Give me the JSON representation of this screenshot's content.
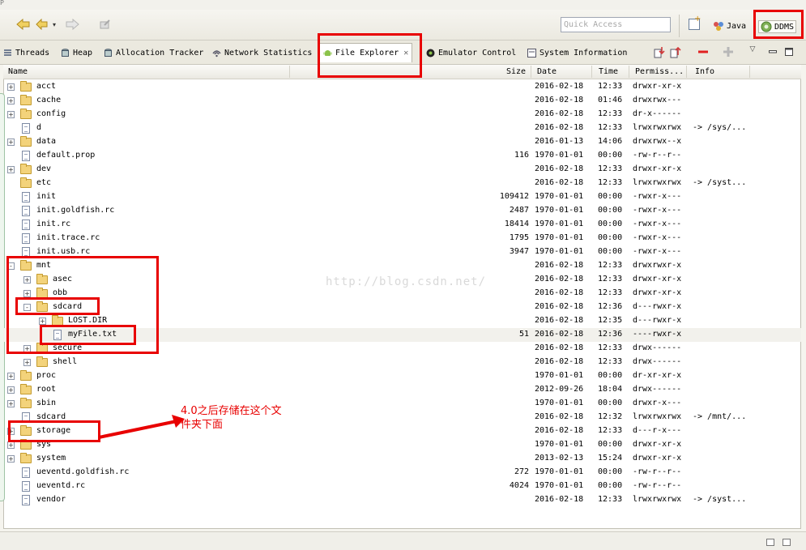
{
  "window": {
    "corner_letter": "P"
  },
  "toolbar": {
    "quick_access_placeholder": "Quick Access",
    "java_label": "Java",
    "ddms_label": "DDMS"
  },
  "tabs": [
    {
      "label": "Threads",
      "icon": "threads-icon"
    },
    {
      "label": "Heap",
      "icon": "heap-icon"
    },
    {
      "label": "Allocation Tracker",
      "icon": "allocation-icon"
    },
    {
      "label": "Network Statistics",
      "icon": "network-icon"
    },
    {
      "label": "File Explorer",
      "icon": "android-icon",
      "active": true
    },
    {
      "label": "Emulator Control",
      "icon": "emulator-icon"
    },
    {
      "label": "System Information",
      "icon": "system-info-icon"
    }
  ],
  "columns": {
    "name": "Name",
    "size": "Size",
    "date": "Date",
    "time": "Time",
    "permissions": "Permiss...",
    "info": "Info"
  },
  "rows": [
    {
      "name": "acct",
      "type": "folder",
      "level": 0,
      "expander": "+",
      "size": "",
      "date": "2016-02-18",
      "time": "12:33",
      "perm": "drwxr-xr-x",
      "info": ""
    },
    {
      "name": "cache",
      "type": "folder",
      "level": 0,
      "expander": "+",
      "size": "",
      "date": "2016-02-18",
      "time": "01:46",
      "perm": "drwxrwx---",
      "info": ""
    },
    {
      "name": "config",
      "type": "folder",
      "level": 0,
      "expander": "+",
      "size": "",
      "date": "2016-02-18",
      "time": "12:33",
      "perm": "dr-x------",
      "info": ""
    },
    {
      "name": "d",
      "type": "file",
      "level": 0,
      "expander": "",
      "size": "",
      "date": "2016-02-18",
      "time": "12:33",
      "perm": "lrwxrwxrwx",
      "info": "-> /sys/..."
    },
    {
      "name": "data",
      "type": "folder",
      "level": 0,
      "expander": "+",
      "size": "",
      "date": "2016-01-13",
      "time": "14:06",
      "perm": "drwxrwx--x",
      "info": ""
    },
    {
      "name": "default.prop",
      "type": "file",
      "level": 0,
      "expander": "",
      "size": "116",
      "date": "1970-01-01",
      "time": "00:00",
      "perm": "-rw-r--r--",
      "info": ""
    },
    {
      "name": "dev",
      "type": "folder",
      "level": 0,
      "expander": "+",
      "size": "",
      "date": "2016-02-18",
      "time": "12:33",
      "perm": "drwxr-xr-x",
      "info": ""
    },
    {
      "name": "etc",
      "type": "folder",
      "level": 0,
      "expander": "",
      "size": "",
      "date": "2016-02-18",
      "time": "12:33",
      "perm": "lrwxrwxrwx",
      "info": "-> /syst..."
    },
    {
      "name": "init",
      "type": "file",
      "level": 0,
      "expander": "",
      "size": "109412",
      "date": "1970-01-01",
      "time": "00:00",
      "perm": "-rwxr-x---",
      "info": ""
    },
    {
      "name": "init.goldfish.rc",
      "type": "file",
      "level": 0,
      "expander": "",
      "size": "2487",
      "date": "1970-01-01",
      "time": "00:00",
      "perm": "-rwxr-x---",
      "info": ""
    },
    {
      "name": "init.rc",
      "type": "file",
      "level": 0,
      "expander": "",
      "size": "18414",
      "date": "1970-01-01",
      "time": "00:00",
      "perm": "-rwxr-x---",
      "info": ""
    },
    {
      "name": "init.trace.rc",
      "type": "file",
      "level": 0,
      "expander": "",
      "size": "1795",
      "date": "1970-01-01",
      "time": "00:00",
      "perm": "-rwxr-x---",
      "info": ""
    },
    {
      "name": "init.usb.rc",
      "type": "file",
      "level": 0,
      "expander": "",
      "size": "3947",
      "date": "1970-01-01",
      "time": "00:00",
      "perm": "-rwxr-x---",
      "info": ""
    },
    {
      "name": "mnt",
      "type": "folder",
      "level": 0,
      "expander": "-",
      "size": "",
      "date": "2016-02-18",
      "time": "12:33",
      "perm": "drwxrwxr-x",
      "info": ""
    },
    {
      "name": "asec",
      "type": "folder",
      "level": 1,
      "expander": "+",
      "size": "",
      "date": "2016-02-18",
      "time": "12:33",
      "perm": "drwxr-xr-x",
      "info": ""
    },
    {
      "name": "obb",
      "type": "folder",
      "level": 1,
      "expander": "+",
      "size": "",
      "date": "2016-02-18",
      "time": "12:33",
      "perm": "drwxr-xr-x",
      "info": ""
    },
    {
      "name": "sdcard",
      "type": "folder",
      "level": 1,
      "expander": "-",
      "size": "",
      "date": "2016-02-18",
      "time": "12:36",
      "perm": "d---rwxr-x",
      "info": ""
    },
    {
      "name": "LOST.DIR",
      "type": "folder",
      "level": 2,
      "expander": "+",
      "size": "",
      "date": "2016-02-18",
      "time": "12:35",
      "perm": "d---rwxr-x",
      "info": ""
    },
    {
      "name": "myFile.txt",
      "type": "file",
      "level": 2,
      "expander": "",
      "size": "51",
      "date": "2016-02-18",
      "time": "12:36",
      "perm": "----rwxr-x",
      "info": "",
      "selected": true
    },
    {
      "name": "secure",
      "type": "folder",
      "level": 1,
      "expander": "+",
      "size": "",
      "date": "2016-02-18",
      "time": "12:33",
      "perm": "drwx------",
      "info": ""
    },
    {
      "name": "shell",
      "type": "folder",
      "level": 1,
      "expander": "+",
      "size": "",
      "date": "2016-02-18",
      "time": "12:33",
      "perm": "drwx------",
      "info": ""
    },
    {
      "name": "proc",
      "type": "folder",
      "level": 0,
      "expander": "+",
      "size": "",
      "date": "1970-01-01",
      "time": "00:00",
      "perm": "dr-xr-xr-x",
      "info": ""
    },
    {
      "name": "root",
      "type": "folder",
      "level": 0,
      "expander": "+",
      "size": "",
      "date": "2012-09-26",
      "time": "18:04",
      "perm": "drwx------",
      "info": ""
    },
    {
      "name": "sbin",
      "type": "folder",
      "level": 0,
      "expander": "+",
      "size": "",
      "date": "1970-01-01",
      "time": "00:00",
      "perm": "drwxr-x---",
      "info": ""
    },
    {
      "name": "sdcard",
      "type": "file",
      "level": 0,
      "expander": "",
      "size": "",
      "date": "2016-02-18",
      "time": "12:32",
      "perm": "lrwxrwxrwx",
      "info": "-> /mnt/..."
    },
    {
      "name": "storage",
      "type": "folder",
      "level": 0,
      "expander": "+",
      "size": "",
      "date": "2016-02-18",
      "time": "12:33",
      "perm": "d---r-x---",
      "info": ""
    },
    {
      "name": "sys",
      "type": "folder",
      "level": 0,
      "expander": "+",
      "size": "",
      "date": "1970-01-01",
      "time": "00:00",
      "perm": "drwxr-xr-x",
      "info": ""
    },
    {
      "name": "system",
      "type": "folder",
      "level": 0,
      "expander": "+",
      "size": "",
      "date": "2013-02-13",
      "time": "15:24",
      "perm": "drwxr-xr-x",
      "info": ""
    },
    {
      "name": "ueventd.goldfish.rc",
      "type": "file",
      "level": 0,
      "expander": "",
      "size": "272",
      "date": "1970-01-01",
      "time": "00:00",
      "perm": "-rw-r--r--",
      "info": ""
    },
    {
      "name": "ueventd.rc",
      "type": "file",
      "level": 0,
      "expander": "",
      "size": "4024",
      "date": "1970-01-01",
      "time": "00:00",
      "perm": "-rw-r--r--",
      "info": ""
    },
    {
      "name": "vendor",
      "type": "file",
      "level": 0,
      "expander": "",
      "size": "",
      "date": "2016-02-18",
      "time": "12:33",
      "perm": "lrwxrwxrwx",
      "info": "-> /syst..."
    }
  ],
  "annotation": {
    "note": "4.0之后存储在这个文件夹下面",
    "watermark": "http://blog.csdn.net/",
    "color": "#e80000"
  }
}
